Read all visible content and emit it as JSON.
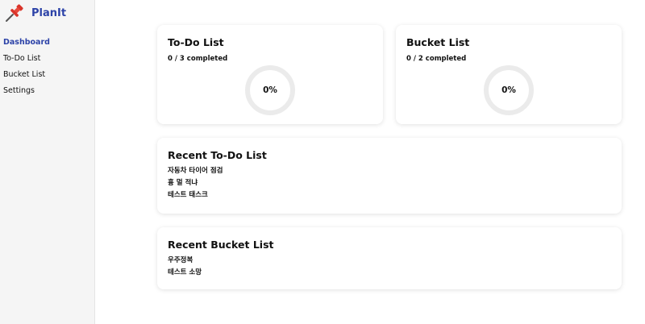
{
  "app": {
    "name": "PlanIt",
    "logo_icon": "pushpin-icon",
    "accent": "#2d43a8",
    "logo_color": "#d9352b"
  },
  "sidebar": {
    "items": [
      {
        "label": "Dashboard",
        "active": true
      },
      {
        "label": "To-Do List",
        "active": false
      },
      {
        "label": "Bucket List",
        "active": false
      },
      {
        "label": "Settings",
        "active": false
      }
    ]
  },
  "todo_card": {
    "title": "To-Do List",
    "completed_text": "0 / 3 completed",
    "completed": 0,
    "total": 3,
    "progress_label": "0%"
  },
  "bucket_card": {
    "title": "Bucket List",
    "completed_text": "0 / 2 completed",
    "completed": 0,
    "total": 2,
    "progress_label": "0%"
  },
  "recent_todo": {
    "title": "Recent To-Do List",
    "items": [
      "자동차 타이어 점검",
      "흉 멀 적냐",
      "테스트 태스크"
    ]
  },
  "recent_bucket": {
    "title": "Recent Bucket List",
    "items": [
      "우주정복",
      "테스트 소망"
    ]
  }
}
